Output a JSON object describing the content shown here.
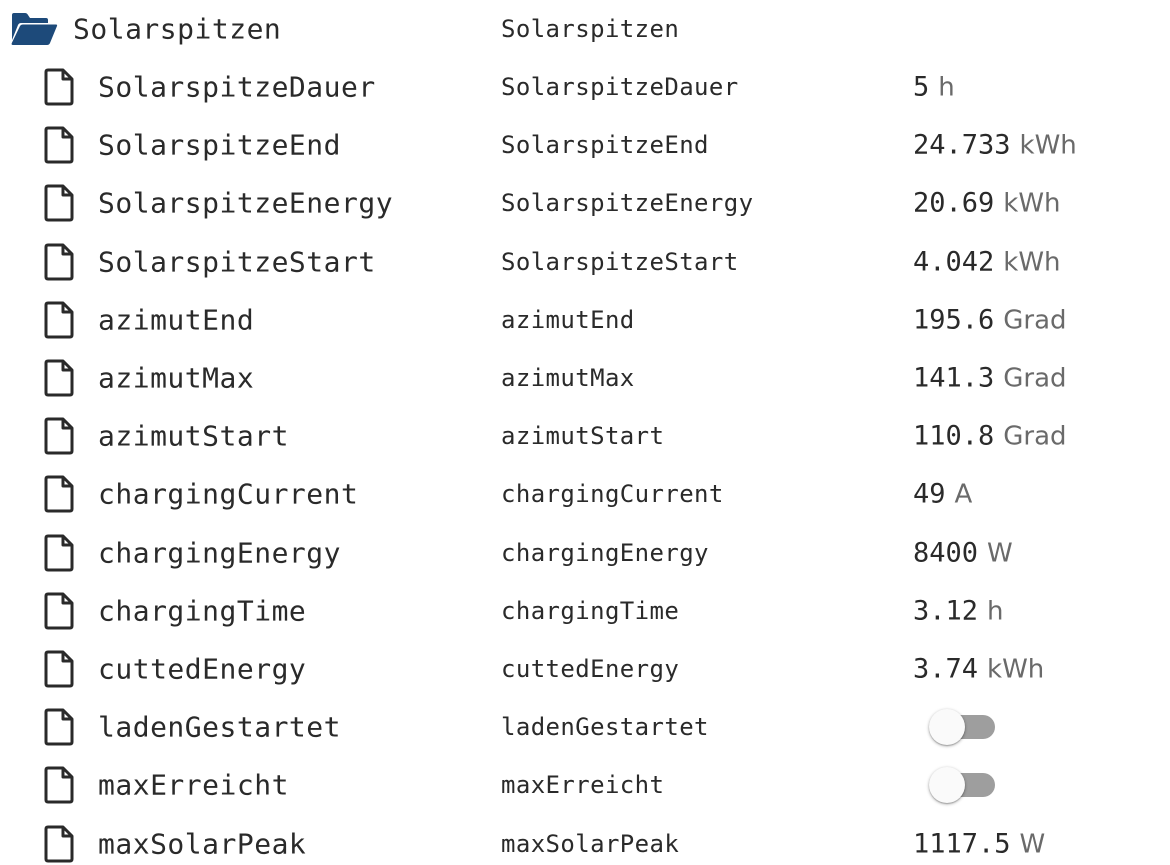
{
  "folder": {
    "name": "Solarspitzen",
    "id": "Solarspitzen",
    "icon": "folder-open-icon",
    "icon_color": "#1d4a7a"
  },
  "items": [
    {
      "name": "SolarspitzeDauer",
      "id": "SolarspitzeDauer",
      "value": "5",
      "unit": "h"
    },
    {
      "name": "SolarspitzeEnd",
      "id": "SolarspitzeEnd",
      "value": "24.733",
      "unit": "kWh"
    },
    {
      "name": "SolarspitzeEnergy",
      "id": "SolarspitzeEnergy",
      "value": "20.69",
      "unit": "kWh"
    },
    {
      "name": "SolarspitzeStart",
      "id": "SolarspitzeStart",
      "value": "4.042",
      "unit": "kWh"
    },
    {
      "name": "azimutEnd",
      "id": "azimutEnd",
      "value": "195.6",
      "unit": "Grad"
    },
    {
      "name": "azimutMax",
      "id": "azimutMax",
      "value": "141.3",
      "unit": "Grad"
    },
    {
      "name": "azimutStart",
      "id": "azimutStart",
      "value": "110.8",
      "unit": "Grad"
    },
    {
      "name": "chargingCurrent",
      "id": "chargingCurrent",
      "value": "49",
      "unit": "A"
    },
    {
      "name": "chargingEnergy",
      "id": "chargingEnergy",
      "value": "8400",
      "unit": "W"
    },
    {
      "name": "chargingTime",
      "id": "chargingTime",
      "value": "3.12",
      "unit": "h"
    },
    {
      "name": "cuttedEnergy",
      "id": "cuttedEnergy",
      "value": "3.74",
      "unit": "kWh"
    },
    {
      "name": "ladenGestartet",
      "id": "ladenGestartet",
      "toggle": false
    },
    {
      "name": "maxErreicht",
      "id": "maxErreicht",
      "toggle": false
    },
    {
      "name": "maxSolarPeak",
      "id": "maxSolarPeak",
      "value": "1117.5",
      "unit": "W"
    }
  ],
  "icons": {
    "file": "file-icon"
  },
  "colors": {
    "text": "#2a2a2a",
    "unit": "#6a6a6a",
    "toggle_track": "#9e9e9e",
    "toggle_knob": "#fafafa"
  }
}
